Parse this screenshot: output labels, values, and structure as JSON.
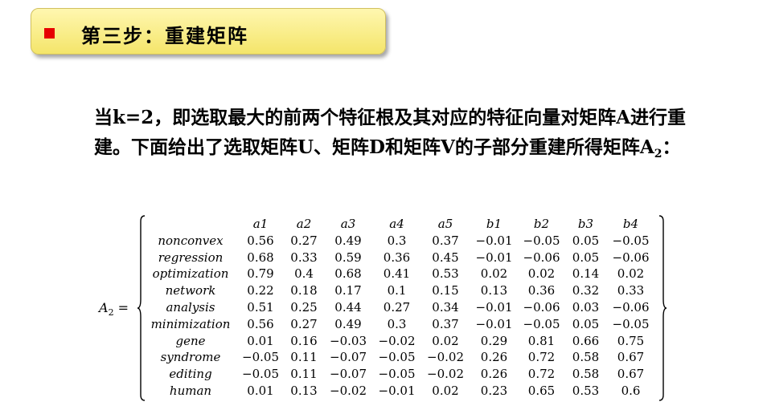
{
  "title": {
    "bullet_color": "#e60000",
    "text": "第三步：重建矩阵"
  },
  "paragraph": {
    "text": "当k=2，即选取最大的前两个特征根及其对应的特征向量对矩阵A进行重建。下面给出了选取矩阵U、矩阵D和矩阵V的子部分重建所得矩阵A",
    "sub": "2",
    "end": "："
  },
  "matrix": {
    "label_main": "A",
    "label_sub": "2",
    "label_eq": " =",
    "columns": [
      "a1",
      "a2",
      "a3",
      "a4",
      "a5",
      "b1",
      "b2",
      "b3",
      "b4"
    ],
    "rows": [
      {
        "name": "nonconvex",
        "values": [
          "0.56",
          "0.27",
          "0.49",
          "0.3",
          "0.37",
          "−0.01",
          "−0.05",
          "0.05",
          "−0.05"
        ]
      },
      {
        "name": "regression",
        "values": [
          "0.68",
          "0.33",
          "0.59",
          "0.36",
          "0.45",
          "−0.01",
          "−0.06",
          "0.05",
          "−0.06"
        ]
      },
      {
        "name": "optimization",
        "values": [
          "0.79",
          "0.4",
          "0.68",
          "0.41",
          "0.53",
          "0.02",
          "0.02",
          "0.14",
          "0.02"
        ]
      },
      {
        "name": "network",
        "values": [
          "0.22",
          "0.18",
          "0.17",
          "0.1",
          "0.15",
          "0.13",
          "0.36",
          "0.32",
          "0.33"
        ]
      },
      {
        "name": "analysis",
        "values": [
          "0.51",
          "0.25",
          "0.44",
          "0.27",
          "0.34",
          "−0.01",
          "−0.06",
          "0.03",
          "−0.06"
        ]
      },
      {
        "name": "minimization",
        "values": [
          "0.56",
          "0.27",
          "0.49",
          "0.3",
          "0.37",
          "−0.01",
          "−0.05",
          "0.05",
          "−0.05"
        ]
      },
      {
        "name": "gene",
        "values": [
          "0.01",
          "0.16",
          "−0.03",
          "−0.02",
          "0.02",
          "0.29",
          "0.81",
          "0.66",
          "0.75"
        ]
      },
      {
        "name": "syndrome",
        "values": [
          "−0.05",
          "0.11",
          "−0.07",
          "−0.05",
          "−0.02",
          "0.26",
          "0.72",
          "0.58",
          "0.67"
        ]
      },
      {
        "name": "editing",
        "values": [
          "−0.05",
          "0.11",
          "−0.07",
          "−0.05",
          "−0.02",
          "0.26",
          "0.72",
          "0.58",
          "0.67"
        ]
      },
      {
        "name": "human",
        "values": [
          "0.01",
          "0.13",
          "−0.02",
          "−0.01",
          "0.02",
          "0.23",
          "0.65",
          "0.53",
          "0.6"
        ]
      }
    ]
  }
}
